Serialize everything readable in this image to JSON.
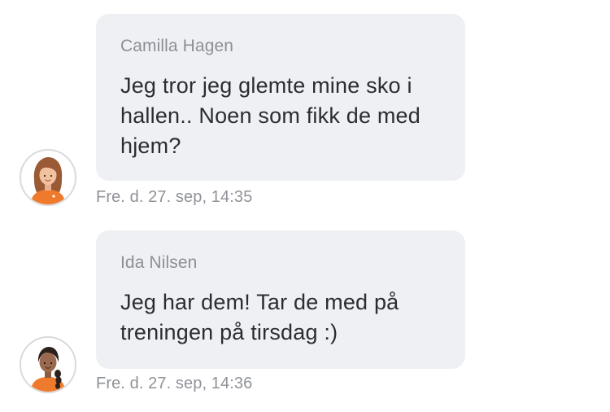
{
  "messages": [
    {
      "sender": "Camilla Hagen",
      "text": "Jeg tror jeg glemte mine sko i hallen.. Noen som fikk de med hjem?",
      "timestamp": "Fre. d. 27. sep, 14:35",
      "avatar_icon": "girl-brown-hair-avatar-icon",
      "avatar_colors": {
        "hair": "#9a5a35",
        "skin": "#f2c2a0",
        "shirt": "#f07a2c"
      }
    },
    {
      "sender": "Ida Nilsen",
      "text": "Jeg har dem! Tar de med på treningen på tirsdag :)",
      "timestamp": "Fre. d. 27. sep, 14:36",
      "avatar_icon": "girl-dark-braid-avatar-icon",
      "avatar_colors": {
        "hair": "#2c211c",
        "skin": "#9b6a4e",
        "shirt": "#f07a2c"
      }
    }
  ],
  "colors": {
    "bubble_background": "#eff0f4",
    "sender_text": "#8c8f96",
    "message_text": "#2b2d33",
    "timestamp_text": "#8f9298"
  }
}
